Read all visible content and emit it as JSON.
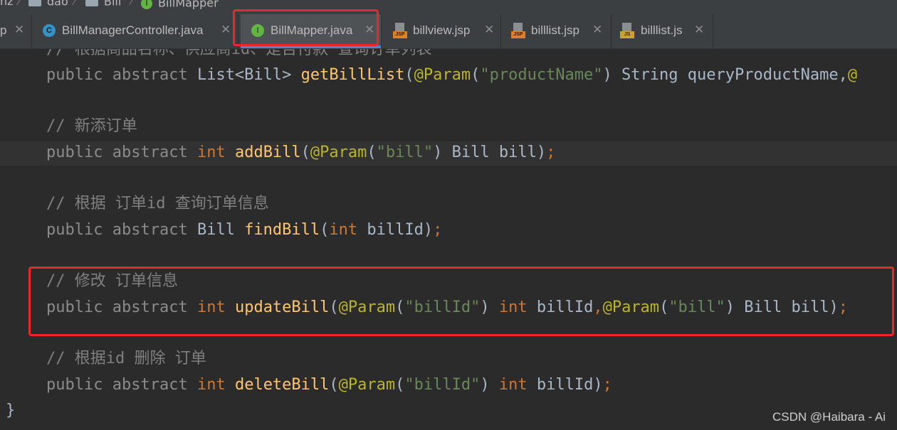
{
  "breadcrumb": {
    "items": [
      "nz",
      "dao",
      "Bill",
      "BillMapper"
    ]
  },
  "tabs": [
    {
      "label": "p",
      "type": "jsp"
    },
    {
      "label": "BillManagerController.java",
      "type": "class"
    },
    {
      "label": "BillMapper.java",
      "type": "interface",
      "active": true
    },
    {
      "label": "billview.jsp",
      "type": "jsp"
    },
    {
      "label": "billlist.jsp",
      "type": "jsp"
    },
    {
      "label": "billlist.js",
      "type": "js"
    }
  ],
  "tab_icons": {
    "class": "C",
    "interface": "I",
    "jsp": "JSP",
    "js": "JS",
    "close": "✕"
  },
  "code": {
    "l0_comment": "// 根据商品名称、供应商id、是否付款 查询订单列表",
    "l1": {
      "kw1": "public",
      "kw2": "abstract",
      "type": "List<Bill>",
      "method": "getBillList",
      "p1": "(",
      "anno": "@Param",
      "p2": "(",
      "str": "\"productName\"",
      "p3": ")",
      "rest": " String queryProductName,",
      "tail": "@"
    },
    "l2_comment": "// 新添订单",
    "l3": {
      "kw1": "public",
      "kw2": "abstract",
      "type": "int",
      "method": "addBill",
      "p1": "(",
      "anno": "@Param",
      "p2": "(",
      "str": "\"bill\"",
      "p3": ")",
      "rest": " Bill bill)",
      "semi": ";"
    },
    "l4_comment": "// 根据 订单id 查询订单信息",
    "l5": {
      "kw1": "public",
      "kw2": "abstract",
      "type": "Bill",
      "method": "findBill",
      "p1": "(",
      "int": "int",
      "rest": " billId)",
      "semi": ";"
    },
    "l6_comment": "// 修改 订单信息",
    "l7": {
      "kw1": "public",
      "kw2": "abstract",
      "type": "int",
      "method": "updateBill",
      "p1": "(",
      "anno": "@Param",
      "p2": "(",
      "str": "\"billId\"",
      "p3": ")",
      "int": "int",
      "mid": " billId",
      "comma": ",",
      "anno2": "@Param",
      "p4": "(",
      "str2": "\"bill\"",
      "p5": ")",
      "rest": " Bill bill)",
      "semi": ";"
    },
    "l8_comment": "// 根据id 删除 订单",
    "l9": {
      "kw1": "public",
      "kw2": "abstract",
      "type": "int",
      "method": "deleteBill",
      "p1": "(",
      "anno": "@Param",
      "p2": "(",
      "str": "\"billId\"",
      "p3": ")",
      "int": "int",
      "rest": " billId)",
      "semi": ";"
    },
    "closing_brace": "}"
  },
  "watermark": "CSDN @Haibara - Ai",
  "colors": {
    "keyword": "#cc7832",
    "method": "#ffc66d",
    "annotation": "#bbb529",
    "string": "#6a8759",
    "comment": "#808080",
    "highlight": "#e8282b"
  }
}
